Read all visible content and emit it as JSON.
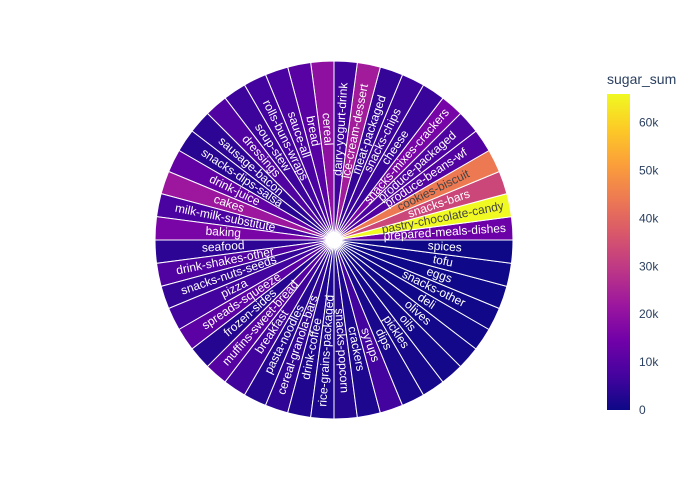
{
  "chart_data": {
    "type": "pie",
    "title": "",
    "colorbar": {
      "title": "sugar_sum",
      "tick_labels": [
        "0",
        "10k",
        "20k",
        "30k",
        "40k",
        "50k",
        "60k"
      ],
      "tick_values": [
        0,
        10000,
        20000,
        30000,
        40000,
        50000,
        60000
      ],
      "range": [
        0,
        66000
      ],
      "colorscale": [
        "#0d0887",
        "#46039f",
        "#7201a8",
        "#9c179e",
        "#bd3786",
        "#d8576b",
        "#ed7953",
        "#fb9f3a",
        "#fdca26",
        "#f0f921"
      ]
    },
    "slices": [
      {
        "label": "prepared-meals-dishes",
        "value": 13500
      },
      {
        "label": "pastry-chocolate-candy",
        "value": 66000
      },
      {
        "label": "snacks-bars",
        "value": 33000
      },
      {
        "label": "cookies-biscuit",
        "value": 44000
      },
      {
        "label": "produce-beans-wf",
        "value": 9500
      },
      {
        "label": "produce-packaged",
        "value": 8500
      },
      {
        "label": "snacks-mixes-crackers",
        "value": 15500
      },
      {
        "label": "cheese",
        "value": 5500
      },
      {
        "label": "snacks-chips",
        "value": 6000
      },
      {
        "label": "meat-packaged",
        "value": 5000
      },
      {
        "label": "ice-cream-dessert",
        "value": 23000
      },
      {
        "label": "dairy-yogurt-drink",
        "value": 6500
      },
      {
        "label": "cereal",
        "value": 19500
      },
      {
        "label": "bread",
        "value": 10500
      },
      {
        "label": "sauce-all",
        "value": 8000
      },
      {
        "label": "rolls-buns-wraps",
        "value": 7000
      },
      {
        "label": "soup-stew",
        "value": 6000
      },
      {
        "label": "dressings",
        "value": 9000
      },
      {
        "label": "sausage-bacon",
        "value": 4000
      },
      {
        "label": "snacks-dips-salsa",
        "value": 3500
      },
      {
        "label": "drink-juice",
        "value": 12000
      },
      {
        "label": "cakes",
        "value": 22000
      },
      {
        "label": "milk-milk-substitute",
        "value": 8000
      },
      {
        "label": "baking",
        "value": 16000
      },
      {
        "label": "seafood",
        "value": 4000
      },
      {
        "label": "drink-shakes-other",
        "value": 9000
      },
      {
        "label": "snacks-nuts-seeds",
        "value": 5000
      },
      {
        "label": "pizza",
        "value": 7000
      },
      {
        "label": "spreads-squeeze",
        "value": 11000
      },
      {
        "label": "frozen-sides",
        "value": 3000
      },
      {
        "label": "muffins-sweet-bread",
        "value": 10000
      },
      {
        "label": "breakfast",
        "value": 6500
      },
      {
        "label": "pasta-noodles",
        "value": 3000
      },
      {
        "label": "cereal-granola-bars",
        "value": 4500
      },
      {
        "label": "drink-coffee",
        "value": 2500
      },
      {
        "label": "rice-grains-packaged",
        "value": 2000
      },
      {
        "label": "snacks-popcorn",
        "value": 3000
      },
      {
        "label": "crackers",
        "value": 2000
      },
      {
        "label": "syrups",
        "value": 7000
      },
      {
        "label": "dips",
        "value": 1500
      },
      {
        "label": "pickles",
        "value": 1200
      },
      {
        "label": "oils",
        "value": 800
      },
      {
        "label": "olives",
        "value": 600
      },
      {
        "label": "deli",
        "value": 500
      },
      {
        "label": "snacks-other",
        "value": 400
      },
      {
        "label": "eggs",
        "value": 300
      },
      {
        "label": "tofu",
        "value": 200
      },
      {
        "label": "spices",
        "value": 150
      }
    ]
  }
}
